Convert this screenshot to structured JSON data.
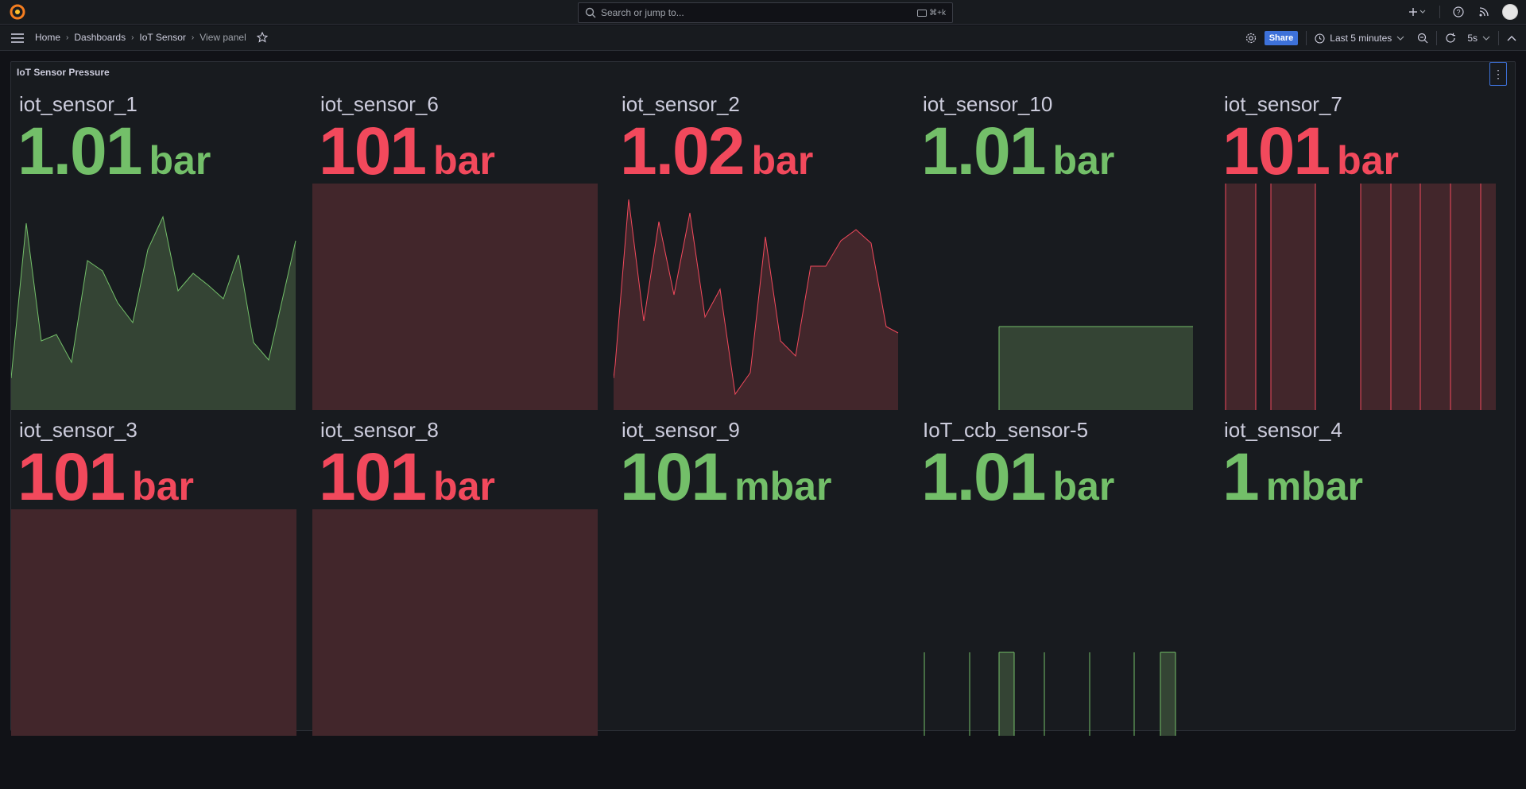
{
  "topbar": {
    "search_placeholder": "Search or jump to...",
    "search_shortcut": "⌘+k"
  },
  "nav": {
    "breadcrumbs": [
      "Home",
      "Dashboards",
      "IoT Sensor",
      "View panel"
    ],
    "share_label": "Share",
    "time_range": "Last 5 minutes",
    "refresh_interval": "5s"
  },
  "panel": {
    "title": "IoT Sensor Pressure",
    "stats": [
      {
        "name": "iot_sensor_1",
        "value": "1.01",
        "unit": "bar",
        "color": "#73bf69",
        "state": "green"
      },
      {
        "name": "iot_sensor_6",
        "value": "101",
        "unit": "bar",
        "color": "#f2495c",
        "state": "red"
      },
      {
        "name": "iot_sensor_2",
        "value": "1.02",
        "unit": "bar",
        "color": "#f2495c",
        "state": "red"
      },
      {
        "name": "iot_sensor_10",
        "value": "1.01",
        "unit": "bar",
        "color": "#73bf69",
        "state": "green"
      },
      {
        "name": "iot_sensor_7",
        "value": "101",
        "unit": "bar",
        "color": "#f2495c",
        "state": "red"
      },
      {
        "name": "iot_sensor_3",
        "value": "101",
        "unit": "bar",
        "color": "#f2495c",
        "state": "red"
      },
      {
        "name": "iot_sensor_8",
        "value": "101",
        "unit": "bar",
        "color": "#f2495c",
        "state": "red"
      },
      {
        "name": "iot_sensor_9",
        "value": "101",
        "unit": "mbar",
        "color": "#73bf69",
        "state": "green"
      },
      {
        "name": "IoT_ccb_sensor-5",
        "value": "1.01",
        "unit": "bar",
        "color": "#73bf69",
        "state": "green"
      },
      {
        "name": "iot_sensor_4",
        "value": "1",
        "unit": "mbar",
        "color": "#73bf69",
        "state": "green"
      }
    ]
  },
  "icons": {
    "logo": "grafana-logo-icon",
    "search": "search-icon",
    "menu": "hamburger-menu-icon",
    "star": "star-icon",
    "settings": "gear-icon",
    "clock": "clock-icon",
    "zoom_out": "zoom-out-icon",
    "refresh": "refresh-icon",
    "collapse": "chevron-up-icon",
    "plus": "plus-icon",
    "help": "help-icon",
    "news": "rss-icon",
    "profile": "avatar-icon"
  }
}
